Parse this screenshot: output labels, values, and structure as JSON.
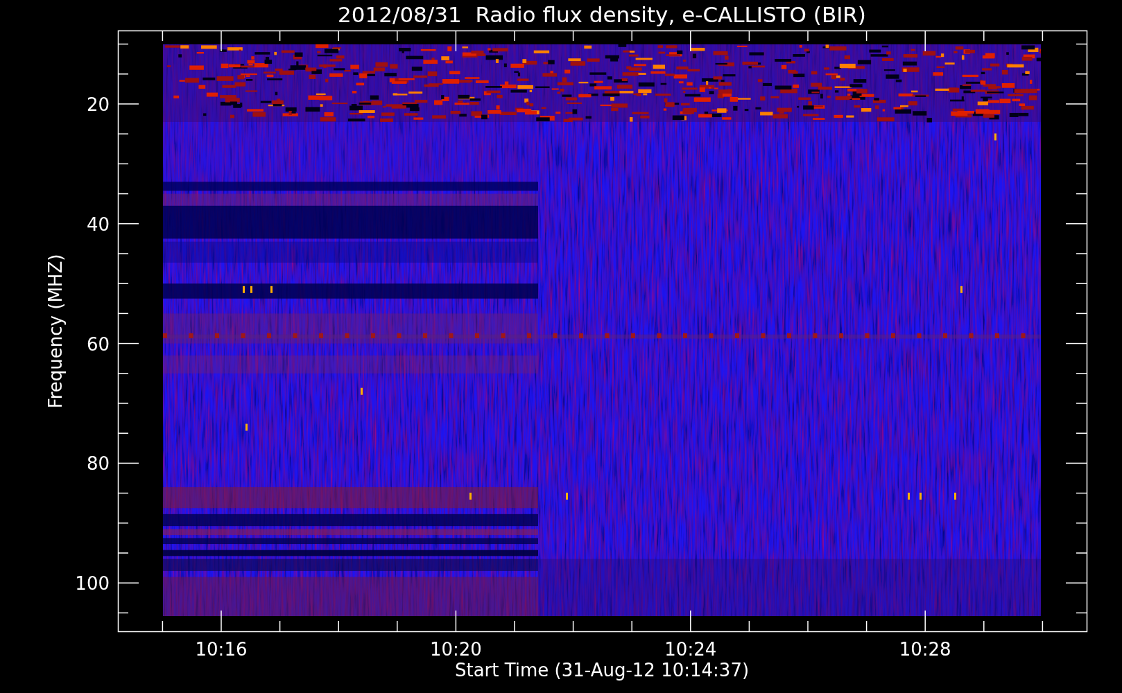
{
  "title": "2012/08/31  Radio flux density, e-CALLISTO (BIR)",
  "y_axis": {
    "label": "Frequency (MHZ)",
    "ticks": [
      "20",
      "40",
      "60",
      "80",
      "100"
    ]
  },
  "x_axis": {
    "label": "Start Time (31-Aug-12 10:14:37)",
    "ticks": [
      "10:16",
      "10:20",
      "10:24",
      "10:28"
    ]
  }
}
